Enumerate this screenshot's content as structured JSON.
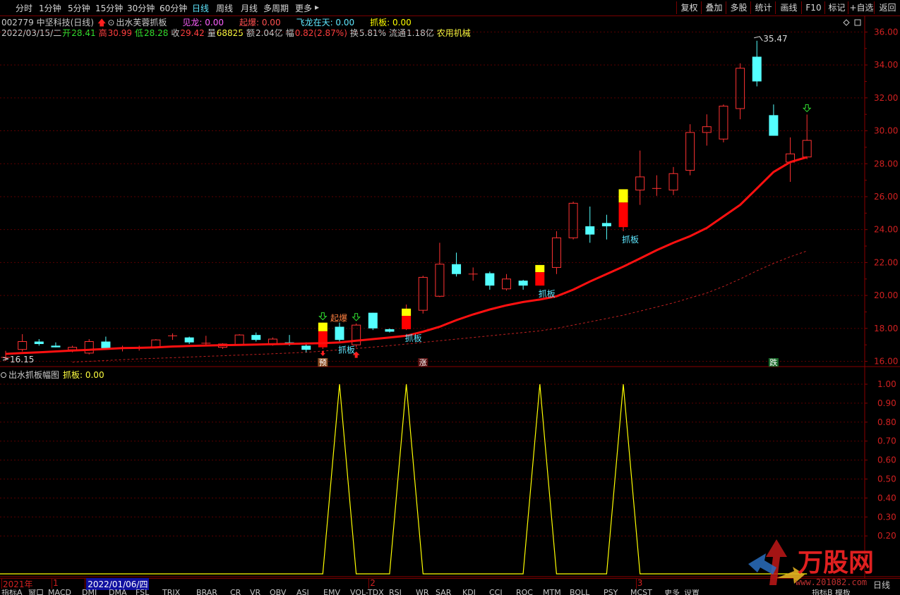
{
  "toolbar": {
    "left_items": [
      "分时",
      "1分钟",
      "5分钟",
      "15分钟",
      "30分钟",
      "60分钟",
      "日线",
      "周线",
      "月线",
      "多周期",
      "更多"
    ],
    "active_item": "日线",
    "more_arrow": "▸",
    "right_items": [
      "复权",
      "叠加",
      "多股",
      "统计",
      "画线",
      "F10",
      "标记",
      "+自选",
      "返回"
    ]
  },
  "stock": {
    "code_name": "002779 中坚科技(日线)",
    "indicator_name": "出水芙蓉抓板",
    "signals": [
      {
        "label": "见龙: 0.00",
        "color": "#ff60ff"
      },
      {
        "label": "起爆: 0.00",
        "color": "#ff5050"
      },
      {
        "label": "飞龙在天: 0.00",
        "color": "#5fe8ff"
      },
      {
        "label": "抓板: 0.00",
        "color": "#ffff00"
      }
    ]
  },
  "quote": {
    "date": "2022/03/15/二",
    "open_label": "开",
    "open": "28.41",
    "high_label": "高",
    "high": "30.99",
    "low_label": "低",
    "low": "28.28",
    "close_label": "收",
    "close": "29.42",
    "vol_label": "量",
    "vol": "68825",
    "amount_label": "额",
    "amount": "2.04亿",
    "change_label": "幅",
    "change": "0.82(2.87%)",
    "turnover_label": "换",
    "turnover": "5.81%",
    "float_label": "流通",
    "float_cap": "1.18亿",
    "sector": "农用机械"
  },
  "main_chart": {
    "price_ticks": [
      "36.00",
      "34.00",
      "32.00",
      "30.00",
      "28.00",
      "26.00",
      "24.00",
      "22.00",
      "20.00",
      "18.00",
      "16.00"
    ],
    "price_tick_values": [
      36,
      34,
      32,
      30,
      28,
      26,
      24,
      22,
      20,
      18,
      16
    ],
    "ylim": [
      15.68,
      36.66
    ],
    "high_marker": "35.47",
    "low_marker": "16.15",
    "labels": {
      "qibao": "起爆",
      "zhuaban": "抓板",
      "yu": "预",
      "zhang": "涨",
      "die": "跌"
    },
    "colors": {
      "up": "#ff3232",
      "down": "#54ffff",
      "ma": "#ff1010",
      "ma_dash": "#c02020",
      "limit": "#ffff00",
      "limit_body": "#ff0000"
    },
    "candles": [
      {
        "o": 16.24,
        "h": 16.64,
        "l": 16.02,
        "c": 16.24
      },
      {
        "o": 16.72,
        "h": 17.65,
        "l": 16.6,
        "c": 17.2
      },
      {
        "o": 17.2,
        "h": 17.35,
        "l": 16.95,
        "c": 17.05
      },
      {
        "o": 16.95,
        "h": 17.15,
        "l": 16.85,
        "c": 16.85
      },
      {
        "o": 16.7,
        "h": 16.95,
        "l": 16.55,
        "c": 16.85
      },
      {
        "o": 16.5,
        "h": 17.35,
        "l": 16.42,
        "c": 17.2
      },
      {
        "o": 17.2,
        "h": 17.5,
        "l": 16.7,
        "c": 16.8
      },
      {
        "o": 16.8,
        "h": 16.95,
        "l": 16.6,
        "c": 16.8
      },
      {
        "o": 16.8,
        "h": 16.95,
        "l": 16.65,
        "c": 16.85
      },
      {
        "o": 16.85,
        "h": 17.35,
        "l": 16.8,
        "c": 17.3
      },
      {
        "o": 17.55,
        "h": 17.7,
        "l": 17.3,
        "c": 17.55
      },
      {
        "o": 17.45,
        "h": 17.5,
        "l": 17.05,
        "c": 17.15
      },
      {
        "o": 17.1,
        "h": 17.55,
        "l": 16.95,
        "c": 17.1
      },
      {
        "o": 16.85,
        "h": 17.1,
        "l": 16.75,
        "c": 17.05
      },
      {
        "o": 17.0,
        "h": 17.65,
        "l": 16.95,
        "c": 17.6
      },
      {
        "o": 17.6,
        "h": 17.75,
        "l": 17.2,
        "c": 17.3
      },
      {
        "o": 17.05,
        "h": 17.45,
        "l": 16.95,
        "c": 17.35
      },
      {
        "o": 17.15,
        "h": 17.6,
        "l": 16.95,
        "c": 17.05
      },
      {
        "o": 16.95,
        "h": 17.15,
        "l": 16.55,
        "c": 16.7
      },
      {
        "o": 16.85,
        "h": 18.35,
        "l": 16.75,
        "c": 18.35,
        "limit": true
      },
      {
        "o": 18.1,
        "h": 18.35,
        "l": 17.2,
        "c": 17.3
      },
      {
        "o": 17.0,
        "h": 18.3,
        "l": 16.85,
        "c": 18.2
      },
      {
        "o": 18.95,
        "h": 18.95,
        "l": 17.9,
        "c": 18.0
      },
      {
        "o": 17.95,
        "h": 18.0,
        "l": 17.75,
        "c": 17.8
      },
      {
        "o": 17.95,
        "h": 19.45,
        "l": 17.9,
        "c": 19.2,
        "limit": true
      },
      {
        "o": 19.1,
        "h": 21.2,
        "l": 18.9,
        "c": 21.1
      },
      {
        "o": 19.95,
        "h": 23.2,
        "l": 19.9,
        "c": 21.9
      },
      {
        "o": 21.9,
        "h": 22.6,
        "l": 21.15,
        "c": 21.3
      },
      {
        "o": 21.3,
        "h": 21.7,
        "l": 20.9,
        "c": 21.3
      },
      {
        "o": 21.35,
        "h": 21.45,
        "l": 20.35,
        "c": 20.6
      },
      {
        "o": 20.4,
        "h": 21.3,
        "l": 20.3,
        "c": 21.0
      },
      {
        "o": 20.9,
        "h": 20.95,
        "l": 20.35,
        "c": 20.6
      },
      {
        "o": 20.6,
        "h": 21.85,
        "l": 20.6,
        "c": 21.85,
        "limit": true
      },
      {
        "o": 21.7,
        "h": 23.9,
        "l": 21.3,
        "c": 23.5
      },
      {
        "o": 23.5,
        "h": 25.7,
        "l": 23.4,
        "c": 25.6
      },
      {
        "o": 24.2,
        "h": 25.4,
        "l": 23.2,
        "c": 23.7
      },
      {
        "o": 24.4,
        "h": 24.9,
        "l": 23.4,
        "c": 24.2
      },
      {
        "o": 24.15,
        "h": 26.45,
        "l": 23.9,
        "c": 26.45,
        "limit": true
      },
      {
        "o": 26.4,
        "h": 28.8,
        "l": 25.5,
        "c": 27.2
      },
      {
        "o": 26.5,
        "h": 27.3,
        "l": 26.05,
        "c": 26.5
      },
      {
        "o": 26.4,
        "h": 27.8,
        "l": 26.1,
        "c": 27.4
      },
      {
        "o": 27.6,
        "h": 30.4,
        "l": 27.3,
        "c": 29.9
      },
      {
        "o": 29.9,
        "h": 31.0,
        "l": 29.1,
        "c": 30.25
      },
      {
        "o": 29.5,
        "h": 31.6,
        "l": 29.3,
        "c": 31.5
      },
      {
        "o": 31.35,
        "h": 34.1,
        "l": 30.7,
        "c": 33.8
      },
      {
        "o": 34.5,
        "h": 35.47,
        "l": 32.7,
        "c": 33.0
      },
      {
        "o": 30.95,
        "h": 31.6,
        "l": 29.7,
        "c": 29.7
      },
      {
        "o": 28.1,
        "h": 29.6,
        "l": 26.9,
        "c": 28.6
      },
      {
        "o": 28.41,
        "h": 30.99,
        "l": 28.28,
        "c": 29.42
      }
    ],
    "ma1": [
      16.45,
      16.5,
      16.55,
      16.6,
      16.65,
      16.7,
      16.75,
      16.8,
      16.82,
      16.85,
      16.9,
      16.93,
      16.96,
      16.98,
      17.0,
      17.02,
      17.04,
      17.06,
      17.08,
      17.1,
      17.15,
      17.25,
      17.35,
      17.45,
      17.55,
      17.8,
      18.1,
      18.5,
      18.85,
      19.15,
      19.4,
      19.6,
      19.75,
      19.95,
      20.35,
      20.85,
      21.3,
      21.75,
      22.25,
      22.75,
      23.2,
      23.6,
      24.1,
      24.8,
      25.5,
      26.5,
      27.5,
      28.1,
      28.4
    ],
    "ma2": [
      null,
      null,
      null,
      null,
      15.95,
      16.0,
      16.05,
      16.1,
      16.15,
      16.18,
      16.22,
      16.26,
      16.3,
      16.34,
      16.38,
      16.42,
      16.46,
      16.5,
      16.55,
      16.62,
      16.7,
      16.78,
      16.86,
      16.95,
      17.05,
      17.15,
      17.25,
      17.35,
      17.45,
      17.55,
      17.65,
      17.75,
      17.85,
      18.0,
      18.2,
      18.4,
      18.6,
      18.8,
      19.05,
      19.3,
      19.55,
      19.85,
      20.15,
      20.55,
      21.0,
      21.5,
      21.95,
      22.35,
      22.7
    ],
    "qibao_index": 20,
    "zhuaban_indices": [
      20,
      24,
      32,
      37
    ],
    "arrow_down_green": [
      19,
      21,
      48
    ],
    "arrow_up_red": [
      21
    ],
    "arrow_down_red": [
      19
    ],
    "yu_index": 19,
    "zhang_index": 25,
    "die_index": 46
  },
  "sub_chart": {
    "title": "出水抓板幅图",
    "value_label": "抓板: 0.00",
    "ticks": [
      "1.00",
      "0.90",
      "0.80",
      "0.70",
      "0.60",
      "0.50",
      "0.40",
      "0.30",
      "0.20"
    ],
    "tick_values": [
      1.0,
      0.9,
      0.8,
      0.7,
      0.6,
      0.5,
      0.4,
      0.3,
      0.2
    ],
    "ylim": [
      0,
      1.0
    ],
    "series_color": "#ffff00"
  },
  "time_axis": {
    "labels": [
      {
        "text": "2021年",
        "index": 0
      },
      {
        "text": "1",
        "index": 3
      },
      {
        "text": "2022/01/06/四",
        "index": 5,
        "highlight": true
      },
      {
        "text": "2",
        "index": 22
      },
      {
        "text": "3",
        "index": 38
      }
    ]
  },
  "bottom_tabs": [
    "指标A",
    "窗口",
    "MACD",
    "DMI",
    "DMA",
    "FSL",
    "TRIX",
    "BRAR",
    "CR",
    "VR",
    "OBV",
    "ASI",
    "EMV",
    "VOL-TDX",
    "RSI",
    "WR",
    "SAR",
    "KDJ",
    "CCI",
    "ROC",
    "MTM",
    "BOLL",
    "PSY",
    "MCST",
    "更多",
    "设置"
  ],
  "bottom_right": [
    "指标B",
    "模板"
  ],
  "right_edge_label": "日线",
  "watermark": {
    "title": "万股网",
    "url": "www.201082.com"
  }
}
